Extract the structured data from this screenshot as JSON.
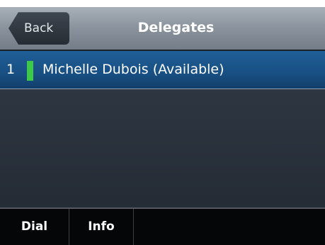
{
  "header": {
    "back_label": "Back",
    "title": "Delegates"
  },
  "delegates": [
    {
      "index": "1",
      "name": "Michelle Dubois (Available)",
      "status_color": "#3ec84a"
    }
  ],
  "softkeys": {
    "dial": "Dial",
    "info": "Info"
  }
}
